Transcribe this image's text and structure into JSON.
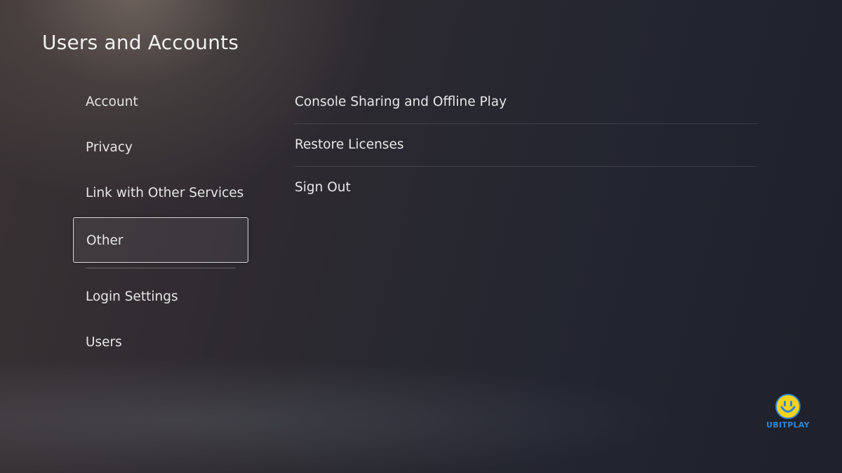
{
  "header": {
    "title": "Users and Accounts"
  },
  "left_menu": {
    "items": [
      {
        "label": "Account"
      },
      {
        "label": "Privacy"
      },
      {
        "label": "Link with Other Services"
      },
      {
        "label": "Other",
        "selected": true
      },
      {
        "label": "Login Settings"
      },
      {
        "label": "Users"
      }
    ]
  },
  "right_menu": {
    "items": [
      {
        "label": "Console Sharing and Offline Play"
      },
      {
        "label": "Restore Licenses"
      },
      {
        "label": "Sign Out"
      }
    ]
  },
  "watermark": {
    "text": "UBITPLAY",
    "icon": "smiley-face-icon",
    "colors": {
      "face": "#f5d21e",
      "outline": "#2f86d6"
    }
  },
  "colors": {
    "background": "#262731",
    "text": "#e6e6e6",
    "focus_border": "#d8d8d8"
  }
}
